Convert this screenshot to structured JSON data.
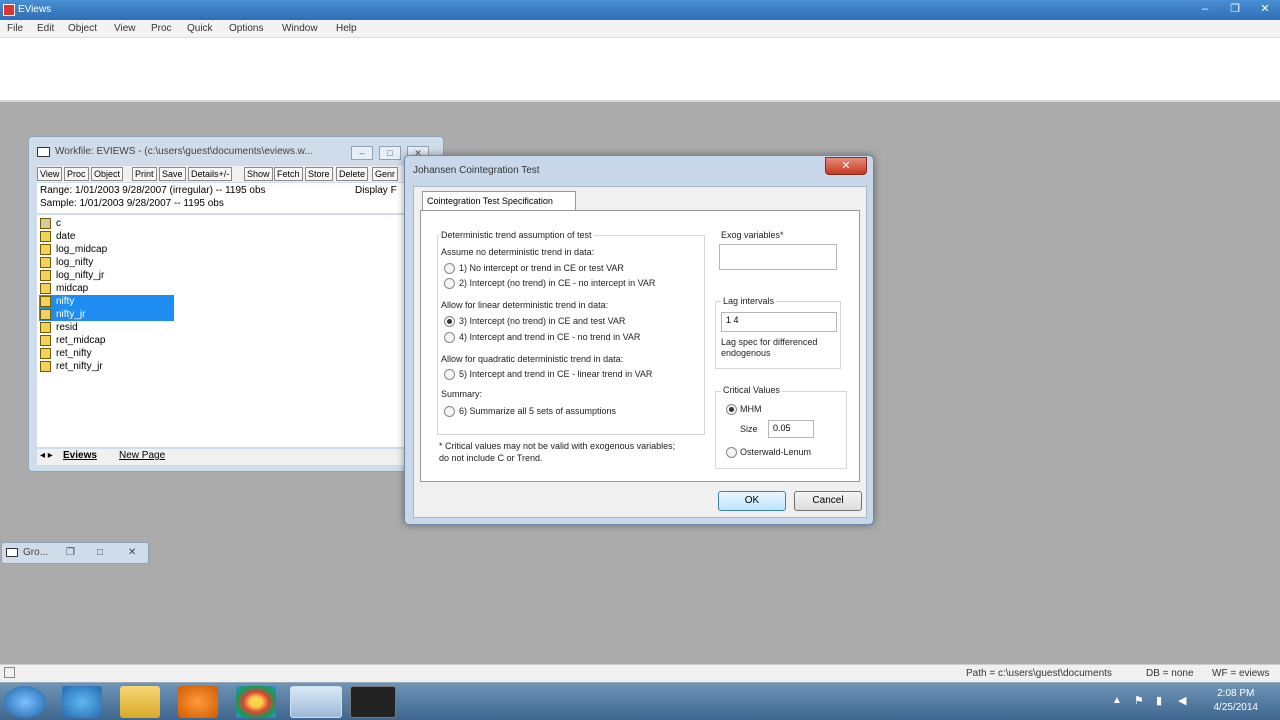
{
  "app": {
    "title": "EViews",
    "win_controls": [
      "–",
      "❐",
      "✕"
    ]
  },
  "menu": [
    "File",
    "Edit",
    "Object",
    "View",
    "Proc",
    "Quick",
    "Options",
    "Window",
    "Help"
  ],
  "workfile": {
    "title": "Workfile: EVIEWS - (c:\\users\\guest\\documents\\eviews.w...",
    "toolbar": [
      "View",
      "Proc",
      "Object",
      "Print",
      "Save",
      "Details+/-",
      "Show",
      "Fetch",
      "Store",
      "Delete",
      "Genr"
    ],
    "range": "Range:   1/01/2003 9/28/2007 (irregular)  --  1195 obs",
    "sample": "Sample: 1/01/2003 9/28/2007  --  1195 obs",
    "display": "Display F",
    "objects": [
      "c",
      "date",
      "log_midcap",
      "log_nifty",
      "log_nifty_jr",
      "midcap",
      "nifty",
      "nifty_jr",
      "resid",
      "ret_midcap",
      "ret_nifty",
      "ret_nifty_jr"
    ],
    "tab_nav": "◂ ▸",
    "tabs": [
      "Eviews",
      "New Page"
    ]
  },
  "group_window": {
    "title": "Gro..."
  },
  "dialog": {
    "title": "Johansen Cointegration Test",
    "tab": "Cointegration Test Specification",
    "trend_group_title": "Deterministic trend assumption of test",
    "section1": "Assume no deterministic trend in data:",
    "opt1": "1)   No intercept or trend in CE or test VAR",
    "opt2": "2)   Intercept (no trend) in CE - no intercept in VAR",
    "section2": "Allow for linear deterministic trend in data:",
    "opt3": "3)   Intercept (no trend) in CE and test VAR",
    "opt4": "4)   Intercept and trend in CE - no trend in VAR",
    "section3": "Allow for quadratic deterministic trend in data:",
    "opt5": "5)   Intercept and trend in CE - linear trend in VAR",
    "section4": "Summary:",
    "opt6": "6)   Summarize all 5 sets of assumptions",
    "note": "* Critical values may not be valid with exogenous variables; do not include C or Trend.",
    "exog_label": "Exog variables*",
    "exog_value": "",
    "lag_label": "Lag intervals",
    "lag_value": "1 4",
    "lag_help": "Lag spec for differenced endogenous",
    "crit_title": "Critical Values",
    "crit_mhm": "MHM",
    "size_label": "Size",
    "size_value": "0.05",
    "crit_ol": "Osterwald-Lenum",
    "ok": "OK",
    "cancel": "Cancel",
    "close": "✕"
  },
  "status": {
    "path": "Path = c:\\users\\guest\\documents",
    "db": "DB = none",
    "wf": "WF = eviews"
  },
  "taskbar": {
    "time": "2:08 PM",
    "date": "4/25/2014"
  }
}
